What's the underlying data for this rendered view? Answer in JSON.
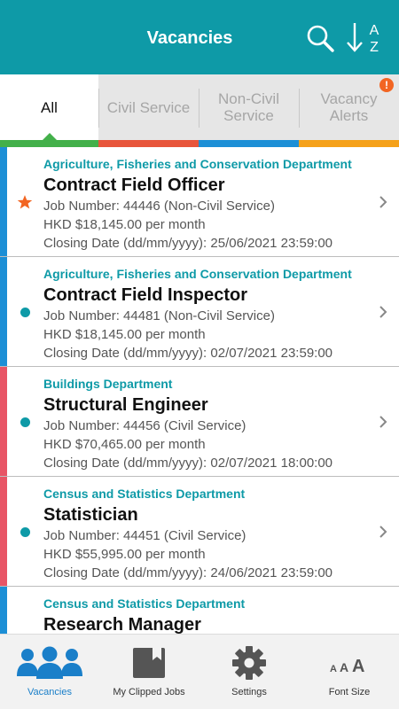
{
  "header": {
    "title": "Vacancies",
    "color": "#0e9aa7",
    "sort_icon_text": "A Z"
  },
  "tabs": [
    {
      "label": "All",
      "bar_color": "#43b04a",
      "active": true
    },
    {
      "label": "Civil Service",
      "bar_color": "#e8553b",
      "active": false
    },
    {
      "label": "Non-Civil Service",
      "bar_color": "#1c8fd6",
      "active": false
    },
    {
      "label": "Vacancy Alerts",
      "bar_color": "#f5a11a",
      "active": false,
      "badge": "!"
    }
  ],
  "jobs": [
    {
      "department": "Agriculture, Fisheries and Conservation Department",
      "title": "Contract Field Officer",
      "job_number": "Job Number: 44446 (Non-Civil Service)",
      "salary": "HKD $18,145.00 per month",
      "closing": "Closing Date (dd/mm/yyyy): 25/06/2021 23:59:00",
      "strip_color": "#1c8fd6",
      "marker": "star",
      "marker_color": "#f26522"
    },
    {
      "department": "Agriculture, Fisheries and Conservation Department",
      "title": "Contract Field Inspector",
      "job_number": "Job Number: 44481 (Non-Civil Service)",
      "salary": "HKD $18,145.00 per month",
      "closing": "Closing Date (dd/mm/yyyy): 02/07/2021 23:59:00",
      "strip_color": "#1c8fd6",
      "marker": "dot",
      "marker_color": "#0e9aa7"
    },
    {
      "department": "Buildings Department",
      "title": "Structural Engineer",
      "job_number": "Job Number: 44456 (Civil Service)",
      "salary": "HKD $70,465.00 per month",
      "closing": "Closing Date (dd/mm/yyyy): 02/07/2021 18:00:00",
      "strip_color": "#e85566",
      "marker": "dot",
      "marker_color": "#0e9aa7"
    },
    {
      "department": "Census and Statistics Department",
      "title": "Statistician",
      "job_number": "Job Number: 44451 (Civil Service)",
      "salary": "HKD $55,995.00 per month",
      "closing": "Closing Date (dd/mm/yyyy): 24/06/2021 23:59:00",
      "strip_color": "#e85566",
      "marker": "dot",
      "marker_color": "#0e9aa7"
    },
    {
      "department": "Census and Statistics Department",
      "title": "Research Manager",
      "job_number": "",
      "salary": "",
      "closing": "",
      "strip_color": "#1c8fd6",
      "marker": "none",
      "marker_color": "#0e9aa7"
    }
  ],
  "bottom_nav": [
    {
      "label": "Vacancies",
      "icon": "people-icon",
      "active": true
    },
    {
      "label": "My Clipped Jobs",
      "icon": "bookmark-folder-icon",
      "active": false
    },
    {
      "label": "Settings",
      "icon": "gear-icon",
      "active": false
    },
    {
      "label": "Font Size",
      "icon": "font-size-icon",
      "icon_text": "AAA",
      "active": false
    }
  ]
}
